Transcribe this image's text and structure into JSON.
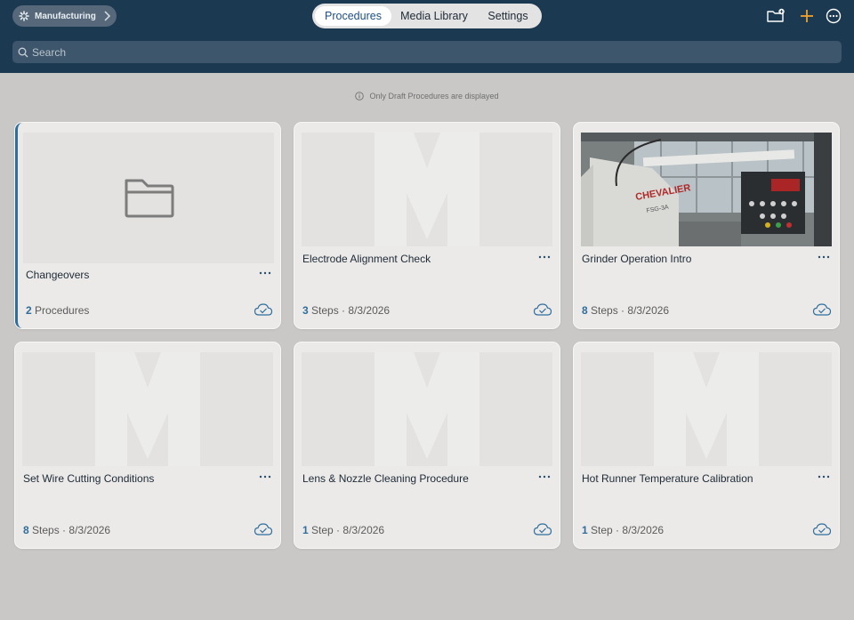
{
  "header": {
    "workspace": "Manufacturing",
    "tabs": [
      "Procedures",
      "Media Library",
      "Settings"
    ],
    "active_tab": "Procedures",
    "icons": [
      "folder-add-icon",
      "plus-icon",
      "more-circle-icon"
    ],
    "accent_color": "#f0a030"
  },
  "search": {
    "placeholder": "Search"
  },
  "notice": "Only Draft Procedures are displayed",
  "cards": [
    {
      "title": "Changeovers",
      "count": "2",
      "unit": "Procedures",
      "date": "",
      "type": "folder"
    },
    {
      "title": "Electrode Alignment Check",
      "count": "3",
      "unit": "Steps",
      "date": "8/3/2026",
      "type": "placeholder"
    },
    {
      "title": "Grinder Operation Intro",
      "count": "8",
      "unit": "Steps",
      "date": "8/3/2026",
      "type": "photo",
      "photo_text": "CHEVALIER",
      "photo_sub": "FSG-3A"
    },
    {
      "title": "Set Wire Cutting Conditions",
      "count": "8",
      "unit": "Steps",
      "date": "8/3/2026",
      "type": "placeholder"
    },
    {
      "title": "Lens & Nozzle Cleaning Procedure",
      "count": "1",
      "unit": "Step",
      "date": "8/3/2026",
      "type": "placeholder"
    },
    {
      "title": "Hot Runner Temperature Calibration",
      "count": "1",
      "unit": "Step",
      "date": "8/3/2026",
      "type": "placeholder"
    }
  ],
  "meta_separator": " · "
}
